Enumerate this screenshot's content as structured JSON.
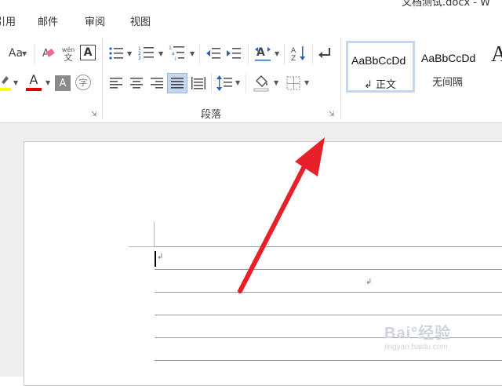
{
  "window": {
    "title_fragment": "文档测试.docx - W"
  },
  "tabs": {
    "references_partial": "引用",
    "mailings": "邮件",
    "review": "审阅",
    "view": "视图"
  },
  "ribbon": {
    "font_group": {
      "change_case_label": "Aa",
      "phonetic_top": "wén",
      "phonetic_bottom": "文",
      "char_border_label": "A",
      "font_color_label": "A",
      "shading_label": "A",
      "enclose_label": "字"
    },
    "paragraph_group": {
      "label": "段落"
    },
    "styles": [
      {
        "sample": "AaBbCcDd",
        "name": "↲ 正文",
        "selected": true
      },
      {
        "sample": "AaBbCcDd",
        "name": "无间隔",
        "selected": false
      }
    ]
  },
  "document": {
    "paragraph_mark": "↲"
  },
  "watermark": {
    "brand": "Bai°经验",
    "url": "jingyan.baidu.com"
  },
  "colors": {
    "highlight": "#ffff00",
    "font_color": "#e00000",
    "selected_style": "#c5d7ee",
    "arrow": "#e8202a"
  }
}
